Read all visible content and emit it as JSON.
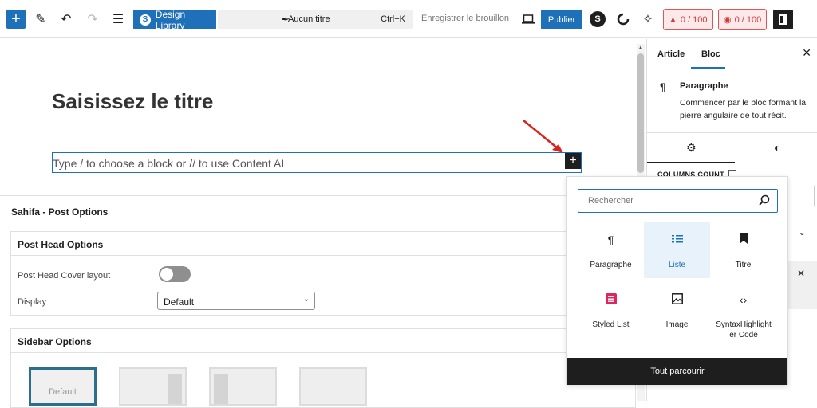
{
  "toolbar": {
    "add_label": "+",
    "design_library": "Design Library",
    "command_title": "Aucun titre",
    "command_shortcut": "Ctrl+K",
    "save_draft": "Enregistrer le brouillon",
    "publish": "Publier",
    "score1": "0 / 100",
    "score2": "0 / 100",
    "accent": "#1e70b8"
  },
  "editor": {
    "title_placeholder": "Saisissez le titre",
    "block_placeholder": "Type / to choose a block or // to use Content AI"
  },
  "meta": {
    "section_title": "Sahifa - Post Options",
    "head_options": {
      "title": "Post Head Options",
      "cover_label": "Post Head Cover layout",
      "display_label": "Display",
      "display_value": "Default"
    },
    "sidebar_options": {
      "title": "Sidebar Options",
      "default_label": "Default"
    }
  },
  "sidebar": {
    "tabs": [
      {
        "label": "Article"
      },
      {
        "label": "Bloc"
      }
    ],
    "block": {
      "name": "Paragraphe",
      "description": "Commencer par le bloc formant la pierre angulaire de tout récit."
    },
    "columns_count": "COLUMNS COUNT"
  },
  "inserter": {
    "search_placeholder": "Rechercher",
    "items": [
      {
        "label": "Paragraphe",
        "icon": "paragraph-icon"
      },
      {
        "label": "Liste",
        "icon": "list-icon"
      },
      {
        "label": "Titre",
        "icon": "bookmark-icon"
      },
      {
        "label": "Styled List",
        "icon": "styled-list-icon"
      },
      {
        "label": "Image",
        "icon": "image-icon"
      },
      {
        "label": "SyntaxHighlight er Code",
        "icon": "code-icon"
      }
    ],
    "browse_all": "Tout parcourir"
  }
}
